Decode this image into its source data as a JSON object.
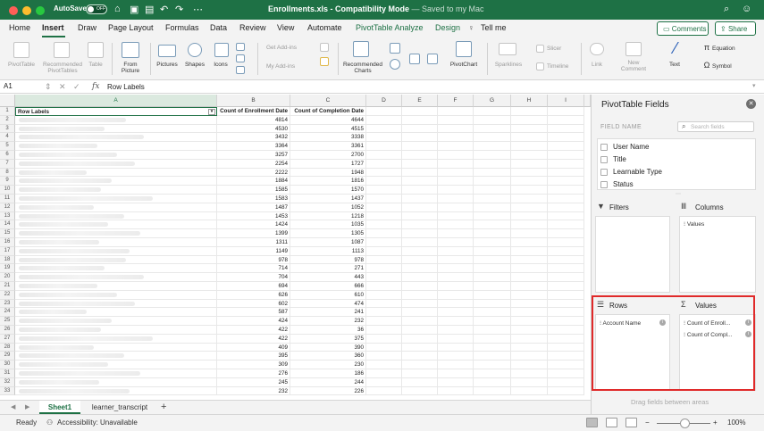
{
  "titlebar": {
    "autosave_label": "AutoSave",
    "autosave_state": "OFF",
    "file_name": "Enrollments.xls",
    "mode": " - Compatibility Mode",
    "save_status": " — Saved to my Mac"
  },
  "menu": {
    "items": [
      "Home",
      "Insert",
      "Draw",
      "Page Layout",
      "Formulas",
      "Data",
      "Review",
      "View",
      "Automate",
      "PivotTable Analyze",
      "Design",
      "Tell me"
    ],
    "active": "Insert",
    "comments_label": "Comments",
    "share_label": "Share"
  },
  "ribbon": {
    "pivottable": "PivotTable",
    "recommended_pivottables": "Recommended PivotTables",
    "table": "Table",
    "from_picture": "From Picture",
    "pictures": "Pictures",
    "shapes": "Shapes",
    "icons": "Icons",
    "get_addins": "Get Add-ins",
    "my_addins": "My Add-ins",
    "recommended_charts": "Recommended Charts",
    "pivotchart": "PivotChart",
    "sparklines": "Sparklines",
    "slicer": "Slicer",
    "timeline": "Timeline",
    "link": "Link",
    "new_comment": "New Comment",
    "text": "Text",
    "equation": "Equation",
    "symbol": "Symbol"
  },
  "formula_bar": {
    "cell_ref": "A1",
    "fx": "fx",
    "value": "Row Labels"
  },
  "grid": {
    "columns": [
      "A",
      "B",
      "C",
      "D",
      "E",
      "F",
      "G",
      "H",
      "I"
    ],
    "header_row": {
      "a": "Row Labels",
      "b": "Count of Enrollment Date",
      "c": "Count of Completion Date"
    },
    "rows": [
      {
        "n": "2",
        "b": "4814",
        "c": "4644"
      },
      {
        "n": "3",
        "b": "4530",
        "c": "4515"
      },
      {
        "n": "4",
        "b": "3432",
        "c": "3338"
      },
      {
        "n": "5",
        "b": "3364",
        "c": "3361"
      },
      {
        "n": "6",
        "b": "3257",
        "c": "2700"
      },
      {
        "n": "7",
        "b": "2254",
        "c": "1727"
      },
      {
        "n": "8",
        "b": "2222",
        "c": "1948"
      },
      {
        "n": "9",
        "b": "1884",
        "c": "1816"
      },
      {
        "n": "10",
        "b": "1585",
        "c": "1570"
      },
      {
        "n": "11",
        "b": "1583",
        "c": "1437"
      },
      {
        "n": "12",
        "b": "1487",
        "c": "1052"
      },
      {
        "n": "13",
        "b": "1453",
        "c": "1218"
      },
      {
        "n": "14",
        "b": "1424",
        "c": "1035"
      },
      {
        "n": "15",
        "b": "1399",
        "c": "1305"
      },
      {
        "n": "16",
        "b": "1311",
        "c": "1087"
      },
      {
        "n": "17",
        "b": "1149",
        "c": "1113"
      },
      {
        "n": "18",
        "b": "978",
        "c": "978"
      },
      {
        "n": "19",
        "b": "714",
        "c": "271"
      },
      {
        "n": "20",
        "b": "704",
        "c": "443"
      },
      {
        "n": "21",
        "b": "694",
        "c": "666"
      },
      {
        "n": "22",
        "b": "626",
        "c": "610"
      },
      {
        "n": "23",
        "b": "602",
        "c": "474"
      },
      {
        "n": "24",
        "b": "587",
        "c": "241"
      },
      {
        "n": "25",
        "b": "424",
        "c": "232"
      },
      {
        "n": "26",
        "b": "422",
        "c": "36"
      },
      {
        "n": "27",
        "b": "422",
        "c": "375"
      },
      {
        "n": "28",
        "b": "409",
        "c": "390"
      },
      {
        "n": "29",
        "b": "395",
        "c": "360"
      },
      {
        "n": "30",
        "b": "309",
        "c": "230"
      },
      {
        "n": "31",
        "b": "276",
        "c": "186"
      },
      {
        "n": "32",
        "b": "245",
        "c": "244"
      },
      {
        "n": "33",
        "b": "232",
        "c": "226"
      }
    ]
  },
  "sheets": {
    "tabs": [
      "Sheet1",
      "learner_transcript"
    ],
    "active": "Sheet1"
  },
  "status": {
    "ready": "Ready",
    "accessibility": "Accessibility: Unavailable",
    "zoom": "100%"
  },
  "pivot_panel": {
    "title": "PivotTable Fields",
    "field_name_label": "FIELD NAME",
    "search_placeholder": "Search fields",
    "fields": [
      "User Name",
      "Title",
      "Learnable Type",
      "Status"
    ],
    "filters_label": "Filters",
    "columns_label": "Columns",
    "columns_items": [
      "Values"
    ],
    "rows_label": "Rows",
    "rows_items": [
      "Account Name"
    ],
    "values_label": "Values",
    "values_items": [
      "Count of Enroll...",
      "Count of Compl..."
    ],
    "hint": "Drag fields between areas"
  },
  "colors": {
    "brand_green": "#1e7145",
    "highlight_red": "#e02a2a"
  }
}
